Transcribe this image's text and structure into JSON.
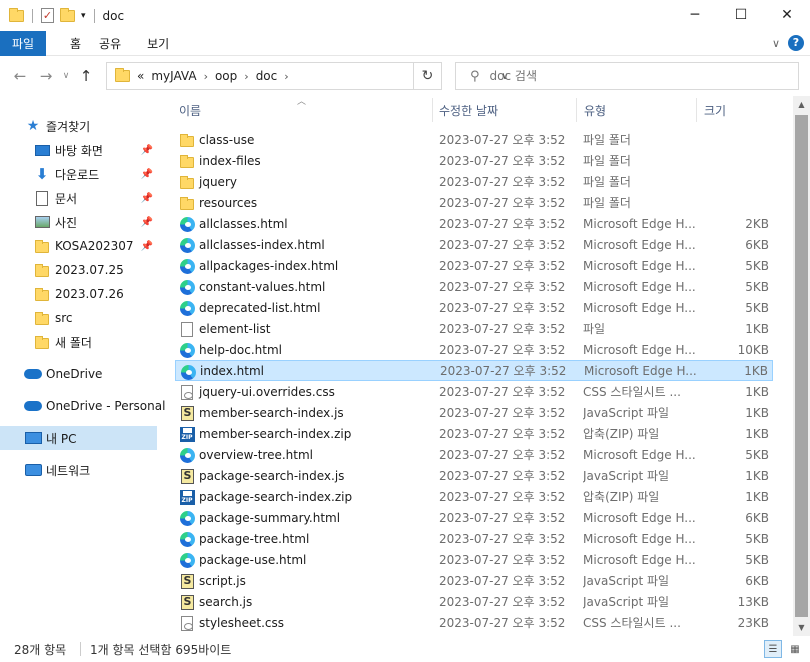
{
  "window": {
    "title": "doc"
  },
  "ribbon": {
    "tabs": [
      "파일",
      "홈",
      "공유",
      "보기"
    ]
  },
  "address": {
    "overflow": "«",
    "crumbs": [
      "myJAVA",
      "oop",
      "doc"
    ]
  },
  "search": {
    "placeholder": "doc 검색"
  },
  "sidebar": {
    "quick_access": "즐겨찾기",
    "items": [
      {
        "label": "바탕 화면",
        "icon": "desktop-icon",
        "pinned": true
      },
      {
        "label": "다운로드",
        "icon": "download-icon",
        "pinned": true
      },
      {
        "label": "문서",
        "icon": "documents-icon",
        "pinned": true
      },
      {
        "label": "사진",
        "icon": "pictures-icon",
        "pinned": true
      },
      {
        "label": "KOSA202307",
        "icon": "folder-icon",
        "pinned": true
      },
      {
        "label": "2023.07.25",
        "icon": "folder-icon",
        "pinned": false
      },
      {
        "label": "2023.07.26",
        "icon": "folder-icon",
        "pinned": false
      },
      {
        "label": "src",
        "icon": "folder-icon",
        "pinned": false
      },
      {
        "label": "새 폴더",
        "icon": "folder-icon",
        "pinned": false
      }
    ],
    "onedrive": "OneDrive",
    "onedrive_personal": "OneDrive - Personal",
    "this_pc": "내 PC",
    "network": "네트워크"
  },
  "columns": {
    "name": "이름",
    "date": "수정한 날짜",
    "type": "유형",
    "size": "크기"
  },
  "files": [
    {
      "name": "class-use",
      "date": "2023-07-27 오후 3:52",
      "type": "파일 폴더",
      "size": "",
      "icon": "folder"
    },
    {
      "name": "index-files",
      "date": "2023-07-27 오후 3:52",
      "type": "파일 폴더",
      "size": "",
      "icon": "folder"
    },
    {
      "name": "jquery",
      "date": "2023-07-27 오후 3:52",
      "type": "파일 폴더",
      "size": "",
      "icon": "folder"
    },
    {
      "name": "resources",
      "date": "2023-07-27 오후 3:52",
      "type": "파일 폴더",
      "size": "",
      "icon": "folder"
    },
    {
      "name": "allclasses.html",
      "date": "2023-07-27 오후 3:52",
      "type": "Microsoft Edge H...",
      "size": "2KB",
      "icon": "edge"
    },
    {
      "name": "allclasses-index.html",
      "date": "2023-07-27 오후 3:52",
      "type": "Microsoft Edge H...",
      "size": "6KB",
      "icon": "edge"
    },
    {
      "name": "allpackages-index.html",
      "date": "2023-07-27 오후 3:52",
      "type": "Microsoft Edge H...",
      "size": "5KB",
      "icon": "edge"
    },
    {
      "name": "constant-values.html",
      "date": "2023-07-27 오후 3:52",
      "type": "Microsoft Edge H...",
      "size": "5KB",
      "icon": "edge"
    },
    {
      "name": "deprecated-list.html",
      "date": "2023-07-27 오후 3:52",
      "type": "Microsoft Edge H...",
      "size": "5KB",
      "icon": "edge"
    },
    {
      "name": "element-list",
      "date": "2023-07-27 오후 3:52",
      "type": "파일",
      "size": "1KB",
      "icon": "blank"
    },
    {
      "name": "help-doc.html",
      "date": "2023-07-27 오후 3:52",
      "type": "Microsoft Edge H...",
      "size": "10KB",
      "icon": "edge"
    },
    {
      "name": "index.html",
      "date": "2023-07-27 오후 3:52",
      "type": "Microsoft Edge H...",
      "size": "1KB",
      "icon": "edge",
      "selected": true
    },
    {
      "name": "jquery-ui.overrides.css",
      "date": "2023-07-27 오후 3:52",
      "type": "CSS 스타일시트 ...",
      "size": "1KB",
      "icon": "css"
    },
    {
      "name": "member-search-index.js",
      "date": "2023-07-27 오후 3:52",
      "type": "JavaScript 파일",
      "size": "1KB",
      "icon": "js"
    },
    {
      "name": "member-search-index.zip",
      "date": "2023-07-27 오후 3:52",
      "type": "압축(ZIP) 파일",
      "size": "1KB",
      "icon": "zip"
    },
    {
      "name": "overview-tree.html",
      "date": "2023-07-27 오후 3:52",
      "type": "Microsoft Edge H...",
      "size": "5KB",
      "icon": "edge"
    },
    {
      "name": "package-search-index.js",
      "date": "2023-07-27 오후 3:52",
      "type": "JavaScript 파일",
      "size": "1KB",
      "icon": "js"
    },
    {
      "name": "package-search-index.zip",
      "date": "2023-07-27 오후 3:52",
      "type": "압축(ZIP) 파일",
      "size": "1KB",
      "icon": "zip"
    },
    {
      "name": "package-summary.html",
      "date": "2023-07-27 오후 3:52",
      "type": "Microsoft Edge H...",
      "size": "6KB",
      "icon": "edge"
    },
    {
      "name": "package-tree.html",
      "date": "2023-07-27 오후 3:52",
      "type": "Microsoft Edge H...",
      "size": "5KB",
      "icon": "edge"
    },
    {
      "name": "package-use.html",
      "date": "2023-07-27 오후 3:52",
      "type": "Microsoft Edge H...",
      "size": "5KB",
      "icon": "edge"
    },
    {
      "name": "script.js",
      "date": "2023-07-27 오후 3:52",
      "type": "JavaScript 파일",
      "size": "6KB",
      "icon": "js"
    },
    {
      "name": "search.js",
      "date": "2023-07-27 오후 3:52",
      "type": "JavaScript 파일",
      "size": "13KB",
      "icon": "js"
    },
    {
      "name": "stylesheet.css",
      "date": "2023-07-27 오후 3:52",
      "type": "CSS 스타일시트 ...",
      "size": "23KB",
      "icon": "css"
    }
  ],
  "status": {
    "item_count": "28개 항목",
    "selection": "1개 항목 선택함 695바이트"
  },
  "colors": {
    "accent": "#1a6fbf",
    "selected_row": "#cce8ff",
    "selected_nav": "#cce4f7"
  }
}
